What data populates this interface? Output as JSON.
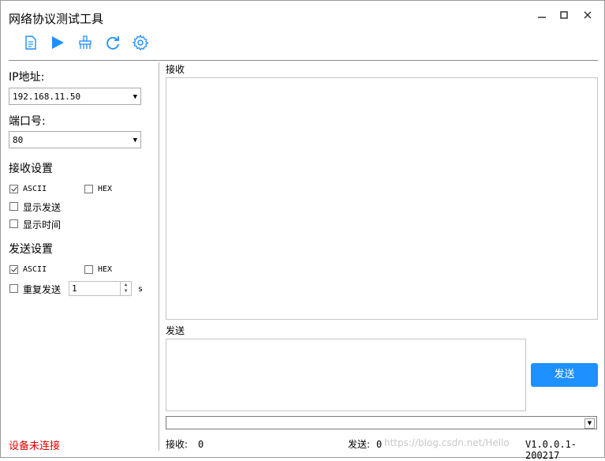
{
  "window": {
    "title": "网络协议测试工具"
  },
  "toolbar": {
    "icons": [
      "document-icon",
      "play-icon",
      "broom-icon",
      "refresh-icon",
      "gear-icon"
    ],
    "accent_color": "#1e90ff"
  },
  "left": {
    "ip_label": "IP地址:",
    "ip_value": "192.168.11.50",
    "port_label": "端口号:",
    "port_value": "80",
    "recv_settings_label": "接收设置",
    "recv_ascii_label": "ASCII",
    "recv_ascii_checked": true,
    "recv_hex_label": "HEX",
    "recv_hex_checked": false,
    "show_send_label": "显示发送",
    "show_send_checked": false,
    "show_time_label": "显示时间",
    "show_time_checked": false,
    "send_settings_label": "发送设置",
    "send_ascii_label": "ASCII",
    "send_ascii_checked": true,
    "send_hex_label": "HEX",
    "send_hex_checked": false,
    "repeat_send_label": "重复发送",
    "repeat_send_checked": false,
    "repeat_interval": "1",
    "repeat_unit": "s",
    "status": "设备未连接"
  },
  "right": {
    "receive_label": "接收",
    "send_label": "发送",
    "send_button": "发送",
    "history_value": ""
  },
  "footer": {
    "recv_count_label": "接收:",
    "recv_count": "0",
    "send_count_label": "发送:",
    "send_count": "0",
    "version": "V1.0.0.1-200217",
    "watermark": "https://blog.csdn.net/Hello"
  }
}
